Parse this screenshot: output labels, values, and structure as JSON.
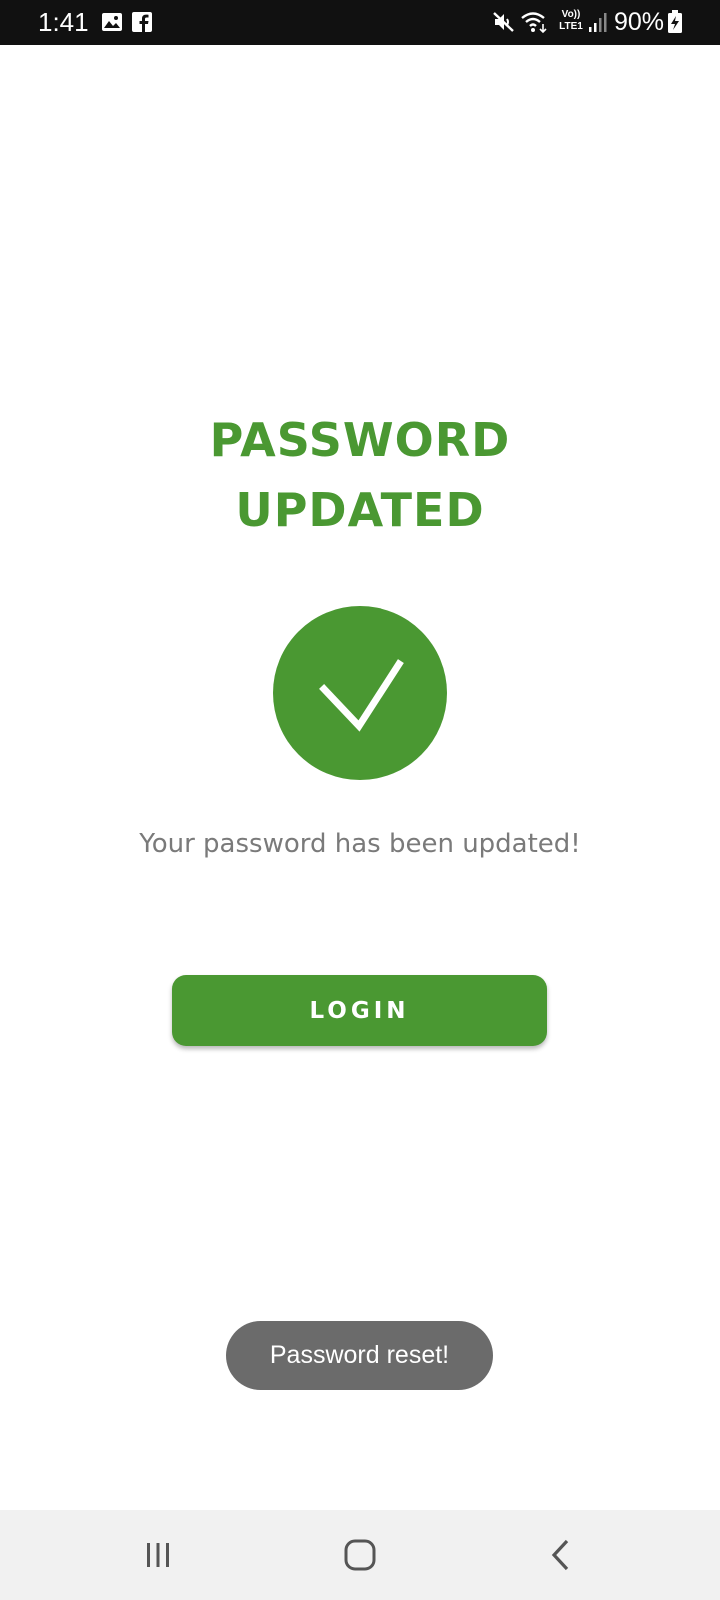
{
  "colors": {
    "accent": "#4a9832",
    "status_bar": "#111111",
    "toast_bg": "#6b6b6b",
    "message_text": "#7a7a7a",
    "nav_bar": "#f1f1f1"
  },
  "status_bar": {
    "time": "1:41",
    "battery_percent": "90%",
    "left_icons": [
      "image-icon",
      "facebook-icon"
    ],
    "right_icons": [
      "mute-icon",
      "wifi-icon",
      "volte-lte-icon",
      "signal-icon",
      "battery-charging-icon"
    ],
    "network_label_top": "Vo))",
    "network_label_bottom": "LTE1"
  },
  "main": {
    "title_line1": "PASSWORD",
    "title_line2": "UPDATED",
    "status_icon": "check-circle-icon",
    "message": "Your password has been updated!",
    "login_label": "LOGIN"
  },
  "toast": {
    "text": "Password reset!"
  },
  "nav_bar": {
    "buttons": [
      "recent-apps-icon",
      "home-icon",
      "back-icon"
    ]
  }
}
